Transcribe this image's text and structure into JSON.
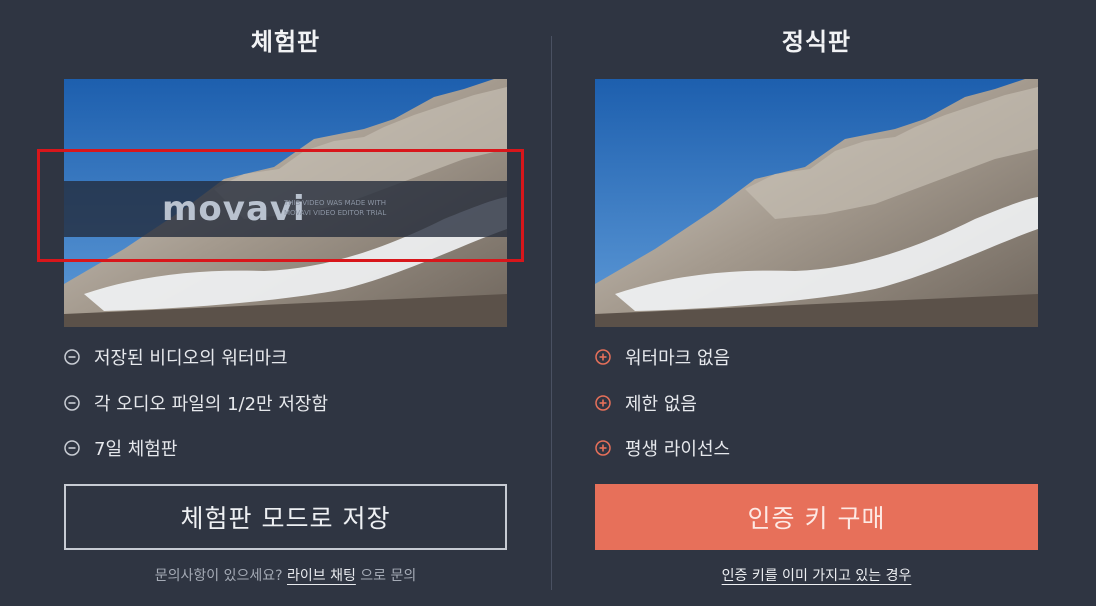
{
  "trial": {
    "title": "체험판",
    "watermark": {
      "logo": "movavi",
      "line1": "THIS VIDEO WAS MADE WITH",
      "line2": "MOVAVI VIDEO EDITOR TRIAL"
    },
    "features": [
      {
        "icon": "minus-circle-icon",
        "text": "저장된 비디오의 워터마크"
      },
      {
        "icon": "minus-circle-icon",
        "text": "각 오디오 파일의 1/2만 저장함"
      },
      {
        "icon": "minus-circle-icon",
        "text": "7일 체험판"
      }
    ],
    "button_label": "체험판 모드로 저장",
    "help_prefix": "문의사항이 있으세요?",
    "help_link": "라이브 채팅",
    "help_suffix": "으로 문의"
  },
  "full": {
    "title": "정식판",
    "features": [
      {
        "icon": "plus-circle-icon",
        "text": "워터마크 없음"
      },
      {
        "icon": "plus-circle-icon",
        "text": "제한 없음"
      },
      {
        "icon": "plus-circle-icon",
        "text": "평생 라이선스"
      }
    ],
    "button_label": "인증 키 구매",
    "help_link": "인증 키를 이미 가지고 있는 경우"
  },
  "colors": {
    "background": "#2f3542",
    "accent": "#e7705a",
    "highlight": "#d8161b",
    "minus_icon": "#c9cdd4",
    "plus_icon": "#e7705a"
  }
}
